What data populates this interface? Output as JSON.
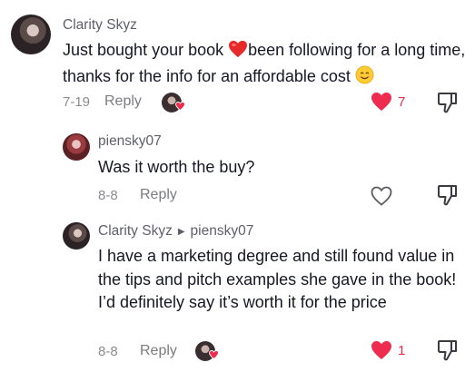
{
  "comments": [
    {
      "author": "Clarity Skyz",
      "text_before": "Just bought your book ",
      "text_after": "been following for a long time, thanks for the info for an affordable cost ",
      "date": "7-19",
      "reply_label": "Reply",
      "likes": "7",
      "liked": true,
      "creator_liked": true
    },
    {
      "author": "piensky07",
      "text": "Was it worth the buy?",
      "date": "8-8",
      "reply_label": "Reply",
      "likes": "",
      "liked": false
    },
    {
      "author": "Clarity Skyz",
      "reply_to": "piensky07",
      "text": "I have a marketing degree and still found value in the tips and pitch examples she gave in the book! I’d definitely say it’s worth it for the price",
      "date": "8-8",
      "reply_label": "Reply",
      "likes": "1",
      "liked": true,
      "creator_liked": true
    }
  ],
  "colors": {
    "like_red": "#ed2c4f",
    "muted_text": "#8a8b91",
    "author_text": "#5f6068"
  },
  "icons": [
    "heart-icon",
    "dislike-icon",
    "red-heart-emoji",
    "smiling-emoji",
    "caret-right-icon",
    "creator-liked-badge"
  ]
}
